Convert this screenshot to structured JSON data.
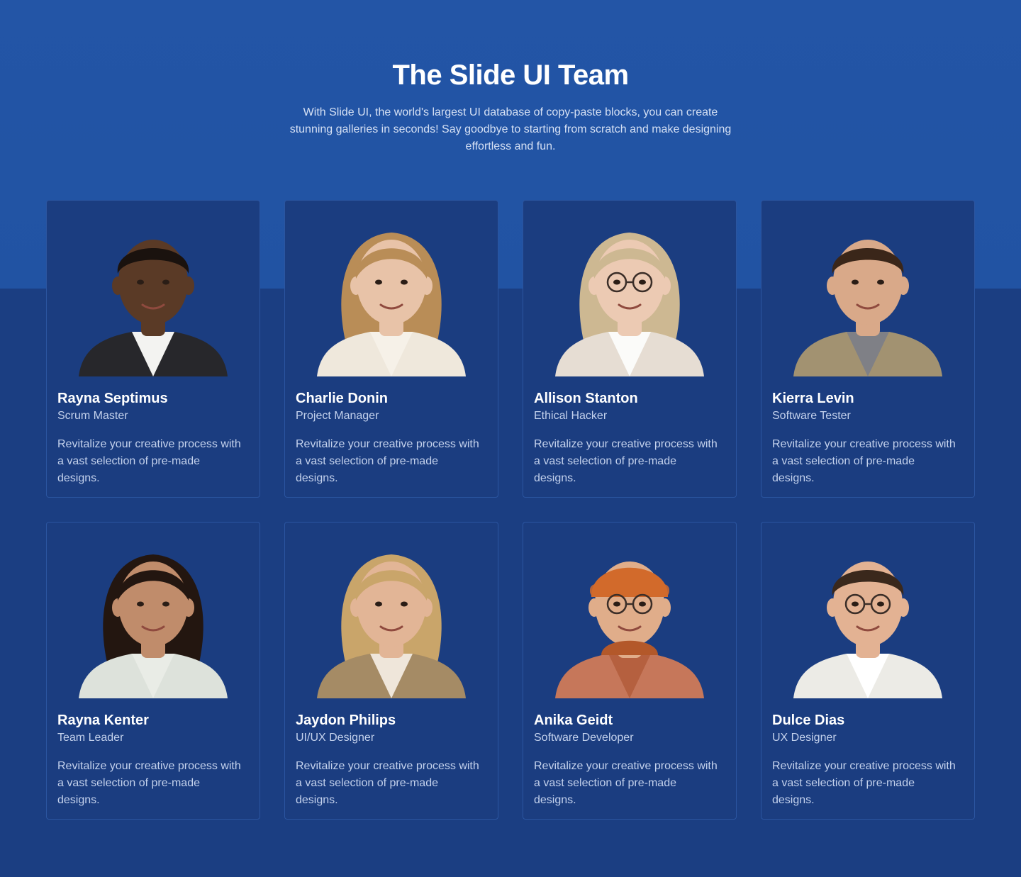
{
  "header": {
    "title": "The Slide UI Team",
    "subtitle": "With Slide UI, the world's largest UI database of copy-paste blocks, you can create stunning galleries in seconds! Say goodbye to starting from scratch and make designing effortless and fun."
  },
  "colors": {
    "top_background": "#2355a6",
    "page_background": "#1b3e82",
    "card_background": "#1b3d80",
    "card_border": "#2b55a0"
  },
  "team": [
    {
      "name": "Rayna Septimus",
      "role": "Scrum Master",
      "description": "Revitalize your creative process with a vast selection of pre-made designs.",
      "skin": "#5a3a26",
      "hair": "#1a120e",
      "shirt": "#27272b",
      "collar": "#f3f3f1",
      "hair_style": "short",
      "glasses": false
    },
    {
      "name": "Charlie Donin",
      "role": "Project Manager",
      "description": "Revitalize your creative process with a vast selection of pre-made designs.",
      "skin": "#e8c3a8",
      "hair": "#b98d57",
      "shirt": "#efe8dc",
      "collar": "#f6f1e8",
      "hair_style": "long",
      "glasses": false
    },
    {
      "name": "Allison Stanton",
      "role": "Ethical Hacker",
      "description": "Revitalize your creative process with a vast selection of pre-made designs.",
      "skin": "#eccab3",
      "hair": "#cdb892",
      "shirt": "#e6ddd3",
      "collar": "#fbfbf9",
      "hair_style": "long",
      "glasses": true
    },
    {
      "name": "Kierra Levin",
      "role": "Software Tester",
      "description": "Revitalize your creative process with a vast selection of pre-made designs.",
      "skin": "#d9a989",
      "hair": "#3a2619",
      "shirt": "#a29271",
      "collar": "#7f8086",
      "hair_style": "short",
      "glasses": false
    },
    {
      "name": "Rayna Kenter",
      "role": "Team Leader",
      "description": "Revitalize your creative process with a vast selection of pre-made designs.",
      "skin": "#c08c6b",
      "hair": "#231610",
      "shirt": "#dde2db",
      "collar": "#e9ece6",
      "hair_style": "long",
      "glasses": false
    },
    {
      "name": "Jaydon Philips",
      "role": "UI/UX Designer",
      "description": "Revitalize your creative process with a vast selection of pre-made designs.",
      "skin": "#e2b596",
      "hair": "#c9a56a",
      "shirt": "#a58b65",
      "collar": "#efe6da",
      "hair_style": "long",
      "glasses": false
    },
    {
      "name": "Anika Geidt",
      "role": "Software Developer",
      "description": "Revitalize your creative process with a vast selection of pre-made designs.",
      "skin": "#e0ad8a",
      "hair": "#d26a2b",
      "shirt": "#c6775a",
      "collar": "#b5603f",
      "hair_style": "beanie",
      "glasses": true
    },
    {
      "name": "Dulce Dias",
      "role": "UX Designer",
      "description": "Revitalize your creative process with a vast selection of pre-made designs.",
      "skin": "#e3b293",
      "hair": "#3a281c",
      "shirt": "#ecebe6",
      "collar": "#ffffff",
      "hair_style": "short",
      "glasses": true
    }
  ]
}
